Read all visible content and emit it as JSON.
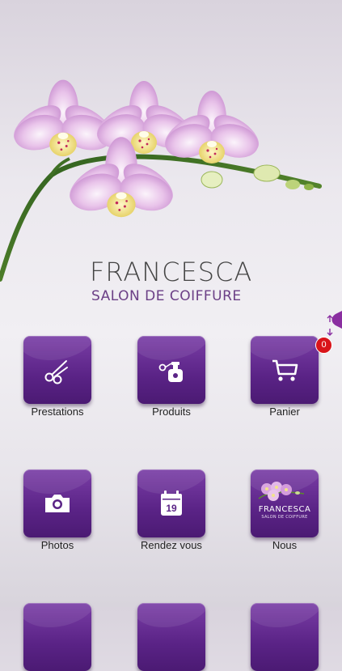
{
  "brand": {
    "title": "FRANCESCA",
    "subtitle": "SALON DE COIFFURE"
  },
  "cart_badge": "0",
  "menu": [
    {
      "label": "Prestations",
      "icon": "scissors-icon"
    },
    {
      "label": "Produits",
      "icon": "perfume-icon"
    },
    {
      "label": "Panier",
      "icon": "cart-icon"
    },
    {
      "label": "Photos",
      "icon": "camera-icon"
    },
    {
      "label": "Rendez vous",
      "icon": "calendar-icon"
    },
    {
      "label": "Nous",
      "icon": "logo-thumbnail"
    }
  ],
  "calendar_day": "19",
  "nous_thumb": {
    "title": "FRANCESCA",
    "subtitle": "SALON DE COIFFURE"
  },
  "colors": {
    "tile": "#5a2386",
    "accent": "#6b3f86",
    "badge": "#d9141a"
  }
}
